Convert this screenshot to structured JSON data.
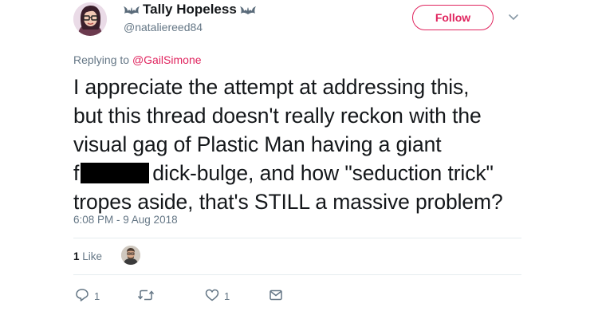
{
  "author": {
    "display_name": "Tally Hopeless",
    "handle": "@nataliereed84"
  },
  "follow_label": "Follow",
  "reply_context": {
    "prefix": "Replying to",
    "mention": "@GailSimone"
  },
  "tweet": {
    "line1": "I appreciate the attempt at addressing this,",
    "line2": "but this thread doesn't really reckon with the",
    "line3": "visual gag of Plastic Man having a giant",
    "line4_prefix": "f",
    "line4_suffix": "dick-bulge, and how \"seduction trick\"",
    "line5": "tropes aside, that's STILL a massive problem?"
  },
  "timestamp": "6:08 PM - 9 Aug 2018",
  "likes": {
    "count": "1",
    "label": "Like"
  },
  "actions": {
    "reply_count": "1",
    "retweet_count": "",
    "like_count": "1"
  },
  "colors": {
    "accent": "#e0245e",
    "secondary_text": "#657786",
    "text": "#14171a",
    "divider": "#e6ecf0"
  },
  "icons": [
    "bat-icon",
    "chevron-down-icon",
    "reply-icon",
    "retweet-icon",
    "heart-icon",
    "message-icon"
  ]
}
